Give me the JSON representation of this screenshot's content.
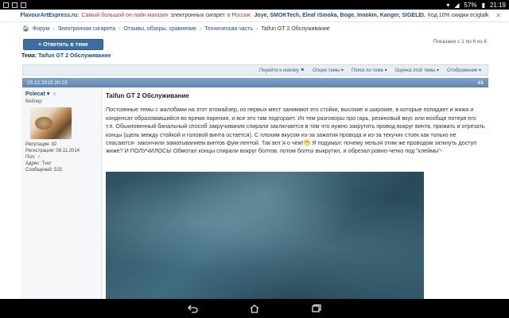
{
  "statusbar": {
    "battery": "57%",
    "time": "21:19"
  },
  "banner": {
    "site": "FlavourArtExpress.ru:",
    "tagline": "Самый большой он-лайн магазин",
    "middle": "электронных сигарет",
    "country": "в России.",
    "brands": "Joye, SMOKTech, Eleaf iSmoka, Boge, Innokin, Kanger, SIGELEI.",
    "promo": "Код 10% скидки eciglalk",
    "close_label": "✕"
  },
  "breadcrumbs": {
    "items": [
      "Форум",
      "Электронная сигарета",
      "Отзывы, обзоры, сравнение",
      "Техническая часть"
    ],
    "current": "Taifun GT 2 Обслуживание"
  },
  "reply_button": "+ Ответить в теме",
  "shown_text": "Показано с 1 по 6 из 6",
  "topic": {
    "label": "Тема:",
    "name": "Taifun GT 2 Обслуживание"
  },
  "toolbar": {
    "items": [
      "Перейти к новому ⚑",
      "Опции темы ▾",
      "Поиск по теме ▾",
      "Оценка этой темы ▾",
      "Отображение ▾"
    ]
  },
  "post": {
    "date": "25.12.2015 20:23",
    "number": "#1",
    "author": {
      "name": "Polecat ▾",
      "title": "Вейпер",
      "reputation": "Репутация: 82",
      "registered": "Регистрация: 08.11.2014",
      "gender": "Пол: ♂",
      "address": "Адрес: Тver",
      "messages": "Сообщений: 515"
    },
    "title": "Taifun GT 2 Обслуживание",
    "body": "Постоянные темы с жалобами на этот атомайзер, из первых мест занимают его стойки, высокие и широкие, в которые попадает и жижа и конденсат образовавшийся во время парения, и все это там подгорает. Из тем разговоры про гарь, резиновый вкус или вообще потеря его т.п. Обыкновенный банальный способ закручивания спирали заключается в том что нужно закрутить провод вокруг винта, прижать и отрезать концы (щель между стойкой и головой винта остается). С плохим вкусом из-за зажатия провода и из-за текучих стоек как только не спасаются- закончили заматыванием винтов фум-лентой. Так вот я о чем!😁 Я подумал: почему нельзя этим же проводом заткнуть доступ жиже? И ПОЛУЧИЛОСЬ! Обмотал концы спирали вокруг болтов, потом болты выкрутил, и обрезал ровно-четко под \"клеймы\"-"
  },
  "colors": {
    "accent": "#3b6ea5",
    "link": "#1c4e86",
    "post_header": "#6f94bd"
  }
}
